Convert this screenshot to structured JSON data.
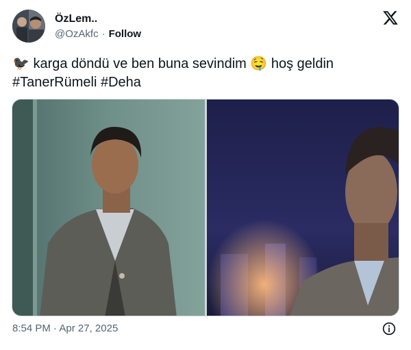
{
  "author": {
    "display_name": "ÖzLem..",
    "handle": "@OzAkfc",
    "separator": "·",
    "follow_label": "Follow"
  },
  "tweet": {
    "bird_emoji": "🐦‍⬛",
    "text": " karga döndü ve ben buna sevindim ",
    "drool_emoji": "🤤",
    "text_after": " hoş geldin",
    "hashtag_1": "#TanerRümeli",
    "hashtag_2": "#Deha"
  },
  "media": {
    "photos": [
      "left-photo",
      "right-photo"
    ]
  },
  "footer": {
    "time": "8:54 PM",
    "separator": "·",
    "date": "Apr 27, 2025"
  },
  "icons": {
    "platform_logo": "x-logo-icon",
    "info": "info-icon"
  },
  "colors": {
    "text_primary": "#0f1419",
    "text_secondary": "#536471",
    "border": "#cfd9de"
  }
}
